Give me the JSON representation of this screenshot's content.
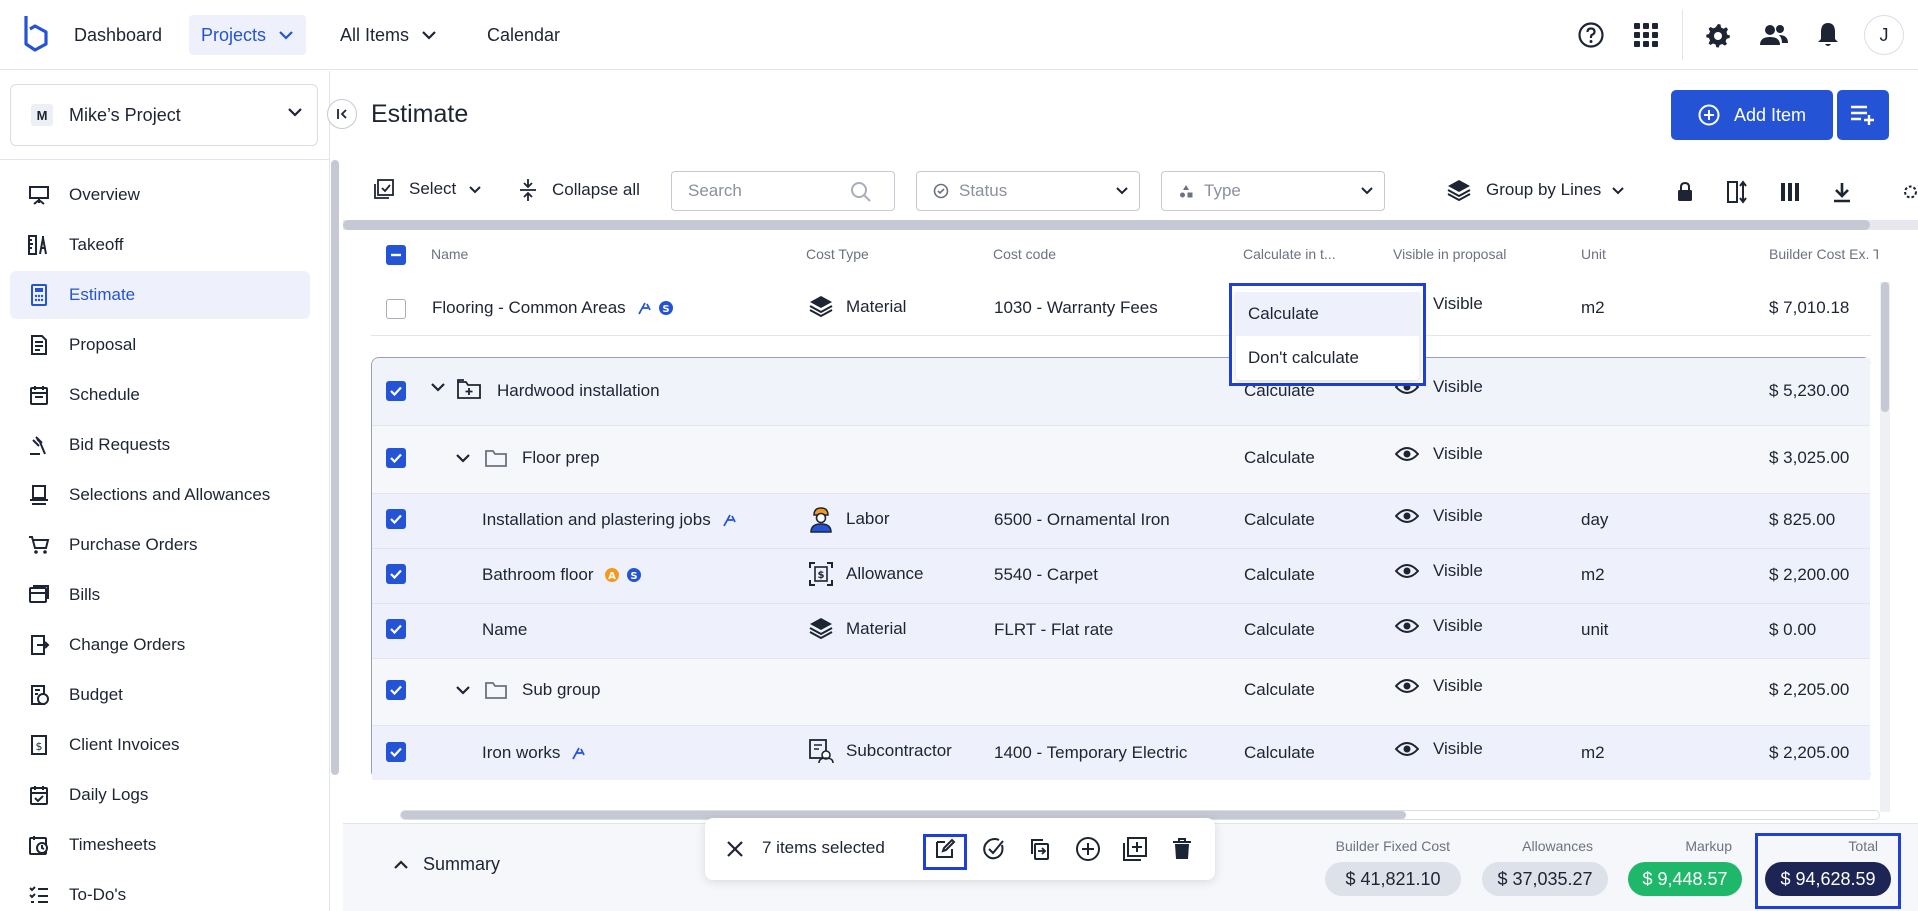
{
  "nav": {
    "dashboard": "Dashboard",
    "projects": "Projects",
    "all_items": "All Items",
    "calendar": "Calendar",
    "avatar_initial": "J"
  },
  "sidebar": {
    "project_badge": "M",
    "project_name": "Mike’s Project",
    "items": [
      {
        "label": "Overview",
        "icon": "presentation-board-icon"
      },
      {
        "label": "Takeoff",
        "icon": "takeoff-ruler-icon"
      },
      {
        "label": "Estimate",
        "icon": "calculator-icon",
        "active": true
      },
      {
        "label": "Proposal",
        "icon": "document-icon"
      },
      {
        "label": "Schedule",
        "icon": "calendar-icon"
      },
      {
        "label": "Bid Requests",
        "icon": "gavel-icon"
      },
      {
        "label": "Selections and Allowances",
        "icon": "kiosk-icon"
      },
      {
        "label": "Purchase Orders",
        "icon": "cart-icon"
      },
      {
        "label": "Bills",
        "icon": "bills-icon"
      },
      {
        "label": "Change Orders",
        "icon": "change-order-icon"
      },
      {
        "label": "Budget",
        "icon": "budget-icon"
      },
      {
        "label": "Client Invoices",
        "icon": "invoice-icon"
      },
      {
        "label": "Daily Logs",
        "icon": "daily-log-icon"
      },
      {
        "label": "Timesheets",
        "icon": "timesheet-icon"
      },
      {
        "label": "To-Do's",
        "icon": "todo-list-icon"
      }
    ]
  },
  "header": {
    "title": "Estimate",
    "add_item": "Add Item"
  },
  "toolbar": {
    "select": "Select",
    "collapse_all": "Collapse all",
    "search_placeholder": "Search",
    "status_placeholder": "Status",
    "type_placeholder": "Type",
    "group_by": "Group by Lines"
  },
  "table": {
    "columns": [
      "Name",
      "Cost Type",
      "Cost code",
      "Calculate in t...",
      "Visible in proposal",
      "Unit",
      "Builder Cost Ex. Ta"
    ],
    "rows": [
      {
        "name": "Flooring - Common Areas",
        "cost_type": "Material",
        "cost_code": "1030 - Warranty Fees",
        "calculate": "",
        "visible": "Visible",
        "unit": "m2",
        "cost": "$ 7,010.18"
      },
      {
        "name": "Hardwood installation",
        "cost_type": "",
        "cost_code": "",
        "calculate": "Calculate",
        "visible": "Visible",
        "unit": "",
        "cost": "$ 5,230.00"
      },
      {
        "name": "Floor prep",
        "cost_type": "",
        "cost_code": "",
        "calculate": "Calculate",
        "visible": "Visible",
        "unit": "",
        "cost": "$ 3,025.00"
      },
      {
        "name": "Installation and plastering jobs",
        "cost_type": "Labor",
        "cost_code": "6500 - Ornamental Iron",
        "calculate": "Calculate",
        "visible": "Visible",
        "unit": "day",
        "cost": "$ 825.00"
      },
      {
        "name": "Bathroom floor",
        "cost_type": "Allowance",
        "cost_code": "5540 - Carpet",
        "calculate": "Calculate",
        "visible": "Visible",
        "unit": "m2",
        "cost": "$ 2,200.00"
      },
      {
        "name": "Name",
        "cost_type": "Material",
        "cost_code": "FLRT - Flat rate",
        "calculate": "Calculate",
        "visible": "Visible",
        "unit": "unit",
        "cost": "$ 0.00"
      },
      {
        "name": "Sub group",
        "cost_type": "",
        "cost_code": "",
        "calculate": "Calculate",
        "visible": "Visible",
        "unit": "",
        "cost": "$ 2,205.00"
      },
      {
        "name": "Iron works",
        "cost_type": "Subcontractor",
        "cost_code": "1400 - Temporary Electric",
        "calculate": "Calculate",
        "visible": "Visible",
        "unit": "m2",
        "cost": "$ 2,205.00"
      }
    ],
    "badge_a": "A",
    "badge_s": "S"
  },
  "dropdown": {
    "options": [
      "Calculate",
      "Don't calculate"
    ]
  },
  "footer": {
    "summary": "Summary",
    "selected": "7 items selected",
    "builder_fixed_cost_label": "Builder Fixed Cost",
    "builder_fixed_cost": "$ 41,821.10",
    "allowances_label": "Allowances",
    "allowances": "$ 37,035.27",
    "markup_label": "Markup",
    "markup": "$ 9,448.57",
    "total_label": "Total",
    "total": "$ 94,628.59"
  },
  "colors": {
    "accent": "#2453d6",
    "highlight_frame": "#1f3fd6",
    "markup_green": "#1fb86b",
    "total_navy": "#1c2553",
    "allowance_orange": "#f39a1e"
  }
}
